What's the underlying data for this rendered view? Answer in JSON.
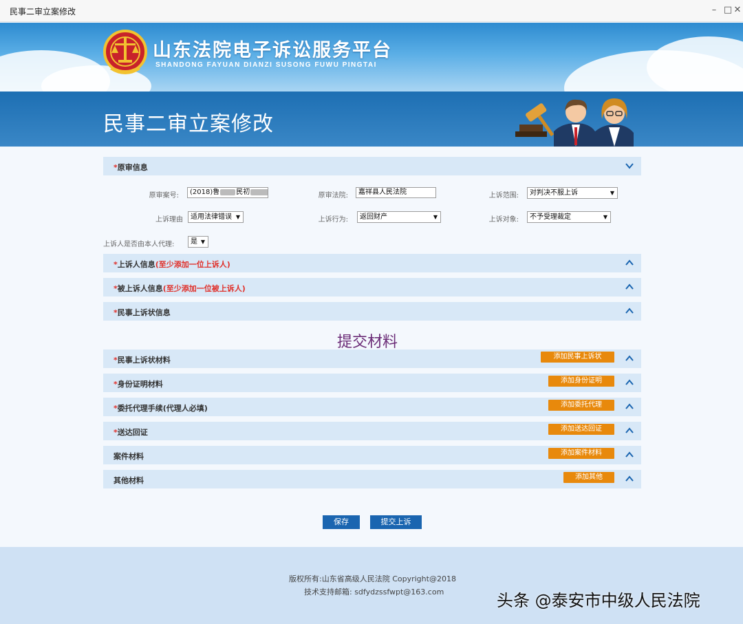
{
  "window": {
    "title": "民事二审立案修改",
    "minimize_icon": "minimize-icon",
    "maximize_icon": "maximize-icon",
    "close_icon": "close-icon"
  },
  "banner": {
    "logo_cn": "山东法院电子诉讼服务平台",
    "logo_en": "SHANDONG FAYUAN DIANZI SUSONG FUWU PINGTAI",
    "page_title": "民事二审立案修改"
  },
  "original_trial": {
    "section_title": "原审信息",
    "required_mark": "*",
    "case_no_label": "原审案号:",
    "case_no_prefix": "(2018)鲁",
    "case_no_mid": "民初",
    "court_label": "原审法院:",
    "court_value": "嘉祥县人民法院",
    "scope_label": "上诉范围:",
    "scope_value": "对判决不服上诉",
    "reason_label": "上诉理由",
    "reason_value": "适用法律错误",
    "action_label": "上诉行为:",
    "action_value": "返回财产",
    "target_label": "上诉对象:",
    "target_value": "不予受理裁定",
    "self_agent_label": "上诉人是否由本人代理:",
    "self_agent_value": "是"
  },
  "sections": {
    "appellant": {
      "label": "上诉人信息",
      "hint": "(至少添加一位上诉人)"
    },
    "appellee": {
      "label": "被上诉人信息",
      "hint": "(至少添加一位被上诉人)"
    },
    "appeal_info": {
      "label": "民事上诉状信息"
    }
  },
  "materials_heading": "提交材料",
  "materials": [
    {
      "label": "民事上诉状材料",
      "required": "*",
      "button": "添加民事上诉状"
    },
    {
      "label": "身份证明材料",
      "required": "*",
      "button": "添加身份证明"
    },
    {
      "label": "委托代理手续(代理人必填)",
      "required": "*",
      "button": "添加委托代理"
    },
    {
      "label": "送达回证",
      "required": "*",
      "button": "添加送达回证"
    },
    {
      "label": "案件材料",
      "required": "",
      "button": "添加案件材料"
    },
    {
      "label": "其他材料",
      "required": "",
      "button": "添加其他"
    }
  ],
  "actions": {
    "save": "保存",
    "submit": "提交上诉"
  },
  "footer": {
    "copyright": "版权所有:山东省高级人民法院 Copyright@2018",
    "support": "技术支持邮箱: sdfydzssfwpt@163.com",
    "watermark": "头条 @泰安市中级人民法院"
  },
  "colors": {
    "primary": "#1a65b0",
    "section_bg": "#d8e8f7",
    "accent_orange": "#e8890c",
    "required_red": "#e0302a",
    "heading_purple": "#6b2c77"
  }
}
